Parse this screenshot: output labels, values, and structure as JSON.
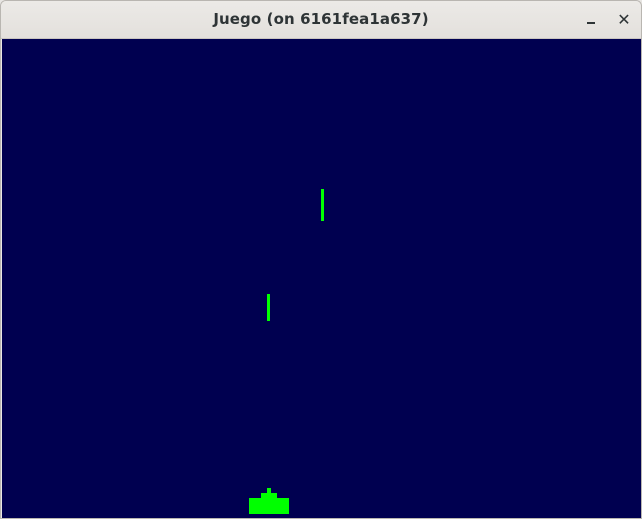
{
  "window": {
    "title": "Juego (on 6161fea1a637)",
    "minimize_icon": "minimize-icon",
    "close_icon": "close-icon",
    "close_glyph": "✕"
  },
  "game": {
    "background_color": "#000050",
    "sprite_color": "#00ff00",
    "bullets": [
      {
        "name": "bullet-upper"
      },
      {
        "name": "bullet-lower"
      }
    ],
    "player": {
      "name": "player-ship"
    }
  }
}
